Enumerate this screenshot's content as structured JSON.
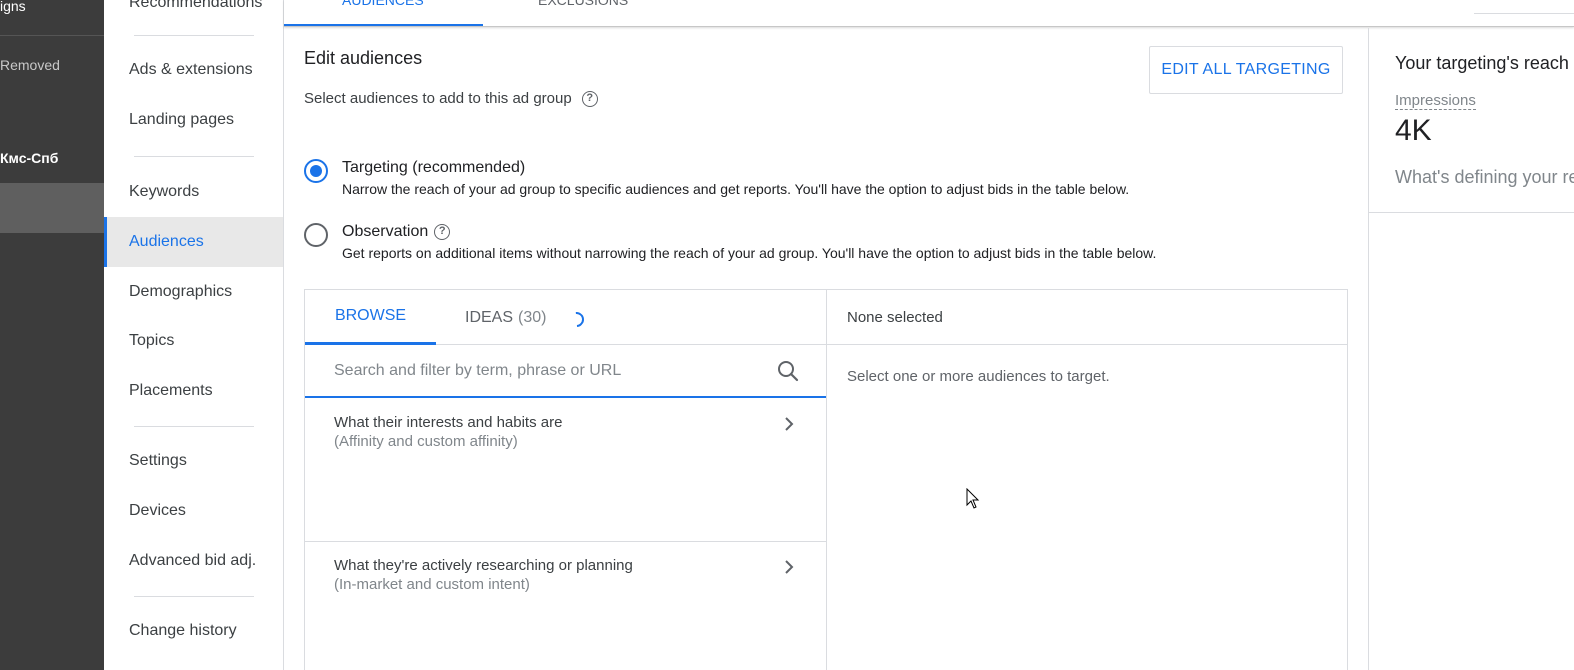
{
  "sidebar_dark": {
    "items": [
      "igns",
      "Removed",
      "Кмс-Спб"
    ]
  },
  "nav": {
    "items": [
      {
        "label": "Recommendations"
      },
      {
        "label": "Ads & extensions"
      },
      {
        "label": "Landing pages"
      },
      {
        "label": "Keywords"
      },
      {
        "label": "Audiences",
        "active": true
      },
      {
        "label": "Demographics"
      },
      {
        "label": "Topics"
      },
      {
        "label": "Placements"
      },
      {
        "label": "Settings"
      },
      {
        "label": "Devices"
      },
      {
        "label": "Advanced bid adj."
      },
      {
        "label": "Change history"
      }
    ]
  },
  "topbar": {
    "tabs": [
      "AUDIENCES",
      "EXCLUSIONS"
    ]
  },
  "main": {
    "title": "Edit audiences",
    "subtitle": "Select audiences to add to this ad group",
    "help_glyph": "?",
    "edit_button": "EDIT ALL TARGETING",
    "options": [
      {
        "label": "Targeting (recommended)",
        "desc": "Narrow the reach of your ad group to specific audiences and get reports. You'll have the option to adjust bids in the table below.",
        "selected": true
      },
      {
        "label": "Observation",
        "desc": "Get reports on additional items without narrowing the reach of your ad group. You'll have the option to adjust bids in the table below.",
        "selected": false
      }
    ],
    "browse": {
      "tab_browse": "BROWSE",
      "tab_ideas": "IDEAS",
      "ideas_count": "(30)",
      "search_placeholder": "Search and filter by term, phrase or URL",
      "categories": [
        {
          "title": "What their interests and habits are",
          "sub": "(Affinity and custom affinity)"
        },
        {
          "title": "What they're actively researching or planning",
          "sub": "(In-market and custom intent)"
        }
      ]
    },
    "selection": {
      "header": "None selected",
      "empty": "Select one or more audiences to target."
    }
  },
  "reach": {
    "title": "Your targeting's reach",
    "label": "Impressions",
    "value": "4K",
    "defining": "What's defining your reach"
  },
  "colors": {
    "accent": "#1a73e8",
    "sidebar_dark": "#3c3c3c"
  }
}
